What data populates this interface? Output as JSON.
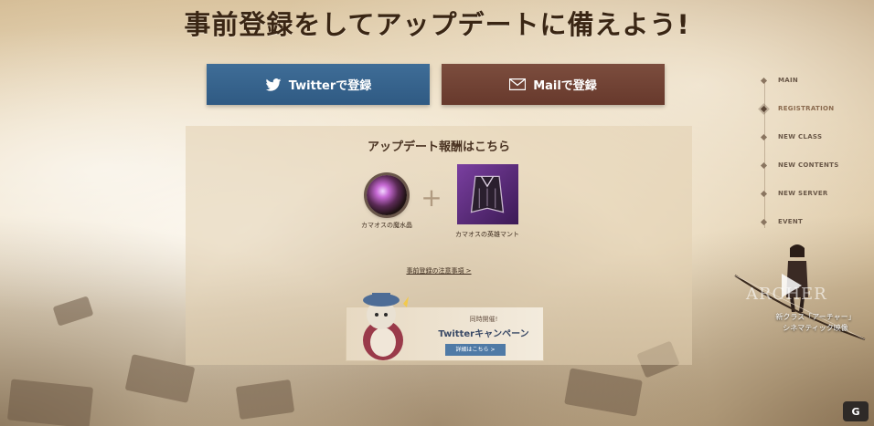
{
  "headline": "事前登録をしてアップデートに備えよう!",
  "buttons": {
    "twitter_label": "Twitterで登録",
    "mail_label": "Mailで登録"
  },
  "rewards": {
    "title": "アップデート報酬はこちら",
    "items": [
      {
        "label": "カマオスの魔水晶",
        "icon": "crystal-orb-icon"
      },
      {
        "label": "カマオスの英雄マント",
        "icon": "cape-icon"
      }
    ],
    "plus": "+",
    "notes_link": "事前登録の注意事項 >"
  },
  "campaign": {
    "sub": "同時開催!",
    "main": "Twitterキャンペーン",
    "detail_button": "詳細はこちら >"
  },
  "side_nav": {
    "items": [
      {
        "label": "MAIN",
        "active": false
      },
      {
        "label": "REGISTRATION",
        "active": true
      },
      {
        "label": "NEW CLASS",
        "active": false
      },
      {
        "label": "NEW CONTENTS",
        "active": false
      },
      {
        "label": "NEW SERVER",
        "active": false
      },
      {
        "label": "EVENT",
        "active": false
      }
    ]
  },
  "archer_promo": {
    "watermark": "ARCHER",
    "caption_line1": "新クラス「アーチャー」",
    "caption_line2": "シネマティック映像"
  },
  "corner_logo": "G",
  "colors": {
    "twitter": "#2f5a83",
    "mail": "#67392c",
    "headline": "#3a2614",
    "campaign_button": "#4f7aa6"
  }
}
